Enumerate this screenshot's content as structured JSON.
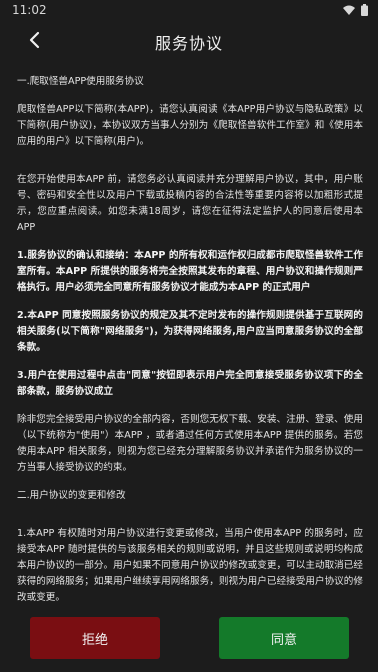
{
  "status_bar": {
    "time": "11:02"
  },
  "header": {
    "title": "服务协议",
    "back_icon": "chevron-left-icon"
  },
  "content": {
    "section1_heading": "一.爬取怪兽APP使用服务协议",
    "p1": "爬取怪兽APP以下简称(本APP)，请您认真阅读《本APP用户协议与隐私政策》以下简称(用户协议)，本协议双方当事人分别为《爬取怪兽软件工作室》和《使用本应用的用户》以下简称(用户)。",
    "p2": "在您开始使用本APP 前，请您务必认真阅读并充分理解用户协议，其中，用户账号、密码和安全性以及用户下载或投稿内容的合法性等重要内容将以加粗形式提示，您应重点阅读。如您未满18周岁，请您在征得法定监护人的同意后使用本APP",
    "p3": "1.服务协议的确认和接纳：本APP 的所有权和运作权归成都市爬取怪兽软件工作室所有。本APP 所提供的服务将完全按照其发布的章程、用户协议和操作规则严格执行。用户必须完全同意所有服务协议才能成为本APP 的正式用户",
    "p4": "2.本APP 同意按照服务协议的规定及其不定时发布的操作规则提供基于互联网的相关服务(以下简称\"网络服务\")，为获得网络服务,用户应当同意服务协议的全部条款。",
    "p5": "3.用户在使用过程中点击\"同意\"按钮即表示用户完全同意接受服务协议项下的全部条款，服务协议成立",
    "p6": "除非您完全接受用户协议的全部内容，否则您无权下载、安装、注册、登录、使用（以下统称为\"使用\"）本APP ，或者通过任何方式使用本APP 提供的服务。若您使用本APP 相关服务，则视为您已经充分理解服务协议并承诺作为服务协议的一方当事人接受协议的约束。",
    "section2_heading": "二.用户协议的变更和修改",
    "p7": "1.本APP 有权随时对用户协议进行变更或修改，当用户使用本APP 的服务时，应接受本APP 随时提供的与该服务相关的规则或说明，并且这些规则或说明均构成本用户协议的一部分。用户如果不同意用户协议的修改或变更，可以主动取消已经获得的网络服务；如果用户继续享用网络服务，则视为用户已经接受用户协议的修改或变更。"
  },
  "buttons": {
    "reject": "拒绝",
    "agree": "同意"
  },
  "colors": {
    "background": "#1c1c1c",
    "reject": "#7a0e12",
    "agree": "#147a2a"
  }
}
